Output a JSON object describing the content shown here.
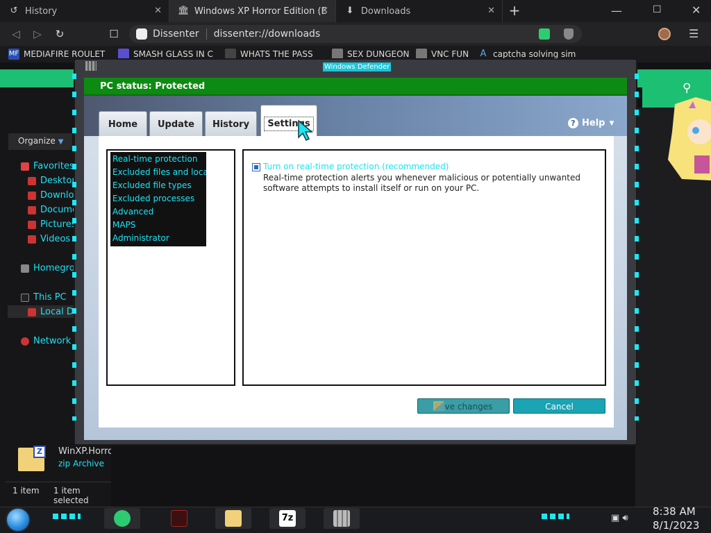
{
  "browser": {
    "tabs": [
      {
        "label": "History",
        "icon": "history-icon"
      },
      {
        "label": "Windows XP Horror Edition (Destr",
        "icon": "bank-icon"
      },
      {
        "label": "Downloads",
        "icon": "download-icon"
      }
    ],
    "url_site": "Dissenter",
    "url_path": "dissenter://downloads"
  },
  "bookmarks": [
    {
      "label": "MEDIAFIRE ROULET",
      "icon_text": "MF"
    },
    {
      "label": "SMASH GLASS IN C",
      "icon_text": ""
    },
    {
      "label": "WHATS THE PASS",
      "icon_text": ""
    },
    {
      "label": "SEX DUNGEON",
      "icon_text": ""
    },
    {
      "label": "VNC FUN",
      "icon_text": ""
    },
    {
      "label": "captcha solving sim",
      "icon_text": "A"
    }
  ],
  "explorer": {
    "organize": "Organize",
    "favorites": "Favorites",
    "desktop": "Desktop",
    "downloads": "Downloads",
    "documents": "Documents",
    "pictures": "Pictures",
    "videos": "Videos",
    "homegroup": "Homegroup",
    "this_pc": "This PC",
    "local_disk": "Local Disk",
    "network": "Network",
    "file_name": "WinXP.Horror",
    "file_type": "zip Archive",
    "status_count": "1 item",
    "status_selected": "1 item selected"
  },
  "defender": {
    "window_title": "Windows Defender",
    "status": "PC status: Protected",
    "tabs": [
      "Home",
      "Update",
      "History",
      "Settings"
    ],
    "help": "Help",
    "settings_list": [
      "Real-time protection",
      "Excluded files and locat...",
      "Excluded file types",
      "Excluded processes",
      "Advanced",
      "MAPS",
      "Administrator"
    ],
    "rt_label": "Turn on real-time protection (recommended)",
    "rt_checked": true,
    "rt_description": "Real-time protection alerts you whenever malicious or potentially unwanted software attempts to install itself or run on your PC.",
    "save_button": "Save changes",
    "cancel_button": "Cancel"
  },
  "taskbar": {
    "zip_label": "7z",
    "time": "8:38 AM",
    "date": "8/1/2023"
  },
  "colors": {
    "accent_cyan": "#1ce4f4",
    "status_green": "#0d8a12",
    "brand_green": "#1dbf73"
  }
}
